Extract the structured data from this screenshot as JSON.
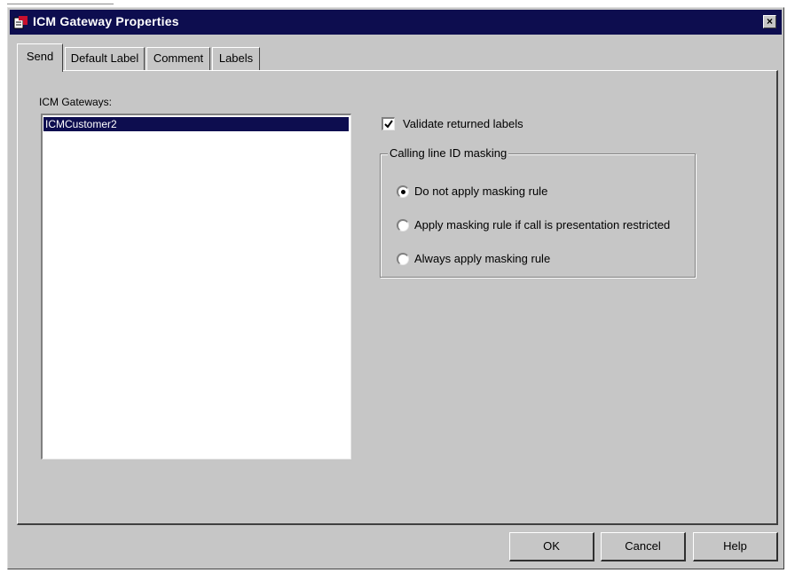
{
  "window": {
    "title": "ICM Gateway Properties",
    "close_glyph": "×",
    "icon": "app-icon"
  },
  "tabs": [
    {
      "label": "Send",
      "active": true
    },
    {
      "label": "Default Label",
      "active": false
    },
    {
      "label": "Comment",
      "active": false
    },
    {
      "label": "Labels",
      "active": false
    }
  ],
  "send": {
    "gateways_label": "ICM Gateways:",
    "gateways": [
      "ICMCustomer2"
    ],
    "selected_gateway": "ICMCustomer2",
    "validate_label": "Validate returned labels",
    "validate_checked": true,
    "masking": {
      "title": "Calling line ID masking",
      "options": [
        {
          "label": "Do not apply masking rule",
          "selected": true
        },
        {
          "label": "Apply masking rule if call is presentation restricted",
          "selected": false
        },
        {
          "label": "Always apply masking rule",
          "selected": false
        }
      ]
    }
  },
  "buttons": {
    "ok": "OK",
    "cancel": "Cancel",
    "help": "Help"
  },
  "colors": {
    "titlebar": "#0d0d4f",
    "face": "#c6c6c6",
    "selection": "#0d0d4f"
  }
}
